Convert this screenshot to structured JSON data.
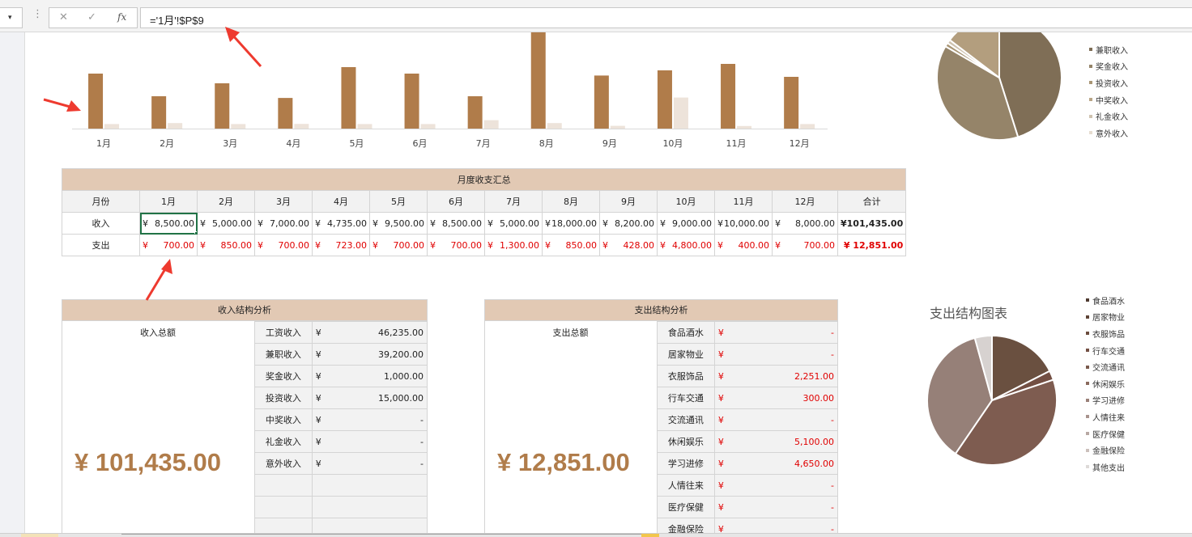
{
  "formula_bar": {
    "name_box_dropdown": "▾",
    "cancel": "✕",
    "confirm": "✓",
    "fx": "fx",
    "formula": "='1月'!$P$9"
  },
  "chart_data": [
    {
      "type": "bar",
      "categories": [
        "1月",
        "2月",
        "3月",
        "4月",
        "5月",
        "6月",
        "7月",
        "8月",
        "9月",
        "10月",
        "11月",
        "12月"
      ],
      "series": [
        {
          "values": [
            8500,
            5000,
            7000,
            4735,
            9500,
            8500,
            5000,
            18000,
            8200,
            9000,
            10000,
            8000
          ],
          "color": "#b07c4a"
        },
        {
          "values": [
            700,
            850,
            700,
            723,
            700,
            700,
            1300,
            850,
            428,
            4800,
            400,
            700
          ],
          "color": "#ede3da"
        }
      ],
      "ylim": [
        0,
        14000
      ],
      "grid": false
    },
    {
      "type": "pie",
      "labels": [
        "兼职收入",
        "奖金收入",
        "投资收入",
        "中奖收入",
        "礼金收入",
        "意外收入"
      ],
      "values": [
        46235,
        39200,
        1000,
        15000,
        0,
        0
      ],
      "legend_position": "right",
      "colors": [
        "#7f6e56",
        "#958469",
        "#a99675",
        "#b9a586",
        "#cfc3b0",
        "#e6ddd0"
      ]
    },
    {
      "type": "pie",
      "title": "支出结构图表",
      "labels": [
        "食品酒水",
        "居家物业",
        "衣服饰品",
        "行车交通",
        "交流通讯",
        "休闲娱乐",
        "学习进修",
        "人情往来",
        "医疗保健",
        "金融保险",
        "其他支出"
      ],
      "values": [
        2251,
        300,
        5100,
        4650,
        550
      ],
      "legend_position": "right",
      "colors": [
        "#6a5040",
        "#734f43",
        "#7a5a4d",
        "#7e5c50",
        "#85645b",
        "#8f7269",
        "#9a8079",
        "#a8938d",
        "#b8a8a3",
        "#cbc0bc",
        "#dedad8"
      ]
    }
  ],
  "income_legend_colors": [
    "#7f6e56",
    "#958469",
    "#a99675",
    "#b9a586",
    "#cfc3b0",
    "#e6ddd0"
  ],
  "expense_legend_colors": [
    "#4e3a30",
    "#5e4436",
    "#6a4c3d",
    "#734f43",
    "#7a5a4d",
    "#8a6a5d",
    "#9a8078",
    "#a8938d",
    "#b8a8a3",
    "#cbc0bc",
    "#dedad8"
  ],
  "monthly_table": {
    "title": "月度收支汇总",
    "headers": [
      "月份",
      "1月",
      "2月",
      "3月",
      "4月",
      "5月",
      "6月",
      "7月",
      "8月",
      "9月",
      "10月",
      "11月",
      "12月",
      "合计"
    ],
    "income_label": "收入",
    "expense_label": "支出",
    "currency": "¥",
    "income": [
      "8,500.00",
      "5,000.00",
      "7,000.00",
      "4,735.00",
      "9,500.00",
      "8,500.00",
      "5,000.00",
      "18,000.00",
      "8,200.00",
      "9,000.00",
      "10,000.00",
      "8,000.00"
    ],
    "income_total": "¥101,435.00",
    "expense": [
      "700.00",
      "850.00",
      "700.00",
      "723.00",
      "700.00",
      "700.00",
      "1,300.00",
      "850.00",
      "428.00",
      "4,800.00",
      "400.00",
      "700.00"
    ],
    "expense_total": "¥ 12,851.00"
  },
  "income_analysis": {
    "title": "收入结构分析",
    "total_label": "收入总额",
    "total_value": "¥   101,435.00",
    "currency": "¥",
    "items": [
      {
        "name": "工资收入",
        "value": "46,235.00"
      },
      {
        "name": "兼职收入",
        "value": "39,200.00"
      },
      {
        "name": "奖金收入",
        "value": "1,000.00"
      },
      {
        "name": "投资收入",
        "value": "15,000.00"
      },
      {
        "name": "中奖收入",
        "value": "-"
      },
      {
        "name": "礼金收入",
        "value": "-"
      },
      {
        "name": "意外收入",
        "value": "-"
      }
    ]
  },
  "expense_analysis": {
    "title": "支出结构分析",
    "total_label": "支出总额",
    "total_value": "¥   12,851.00",
    "currency": "¥",
    "items": [
      {
        "name": "食品酒水",
        "value": "-"
      },
      {
        "name": "居家物业",
        "value": "-"
      },
      {
        "name": "衣服饰品",
        "value": "2,251.00"
      },
      {
        "name": "行车交通",
        "value": "300.00"
      },
      {
        "name": "交流通讯",
        "value": "-"
      },
      {
        "name": "休闲娱乐",
        "value": "5,100.00"
      },
      {
        "name": "学习进修",
        "value": "4,650.00"
      },
      {
        "name": "人情往来",
        "value": "-"
      },
      {
        "name": "医疗保健",
        "value": "-"
      },
      {
        "name": "金融保险",
        "value": "-"
      }
    ]
  }
}
